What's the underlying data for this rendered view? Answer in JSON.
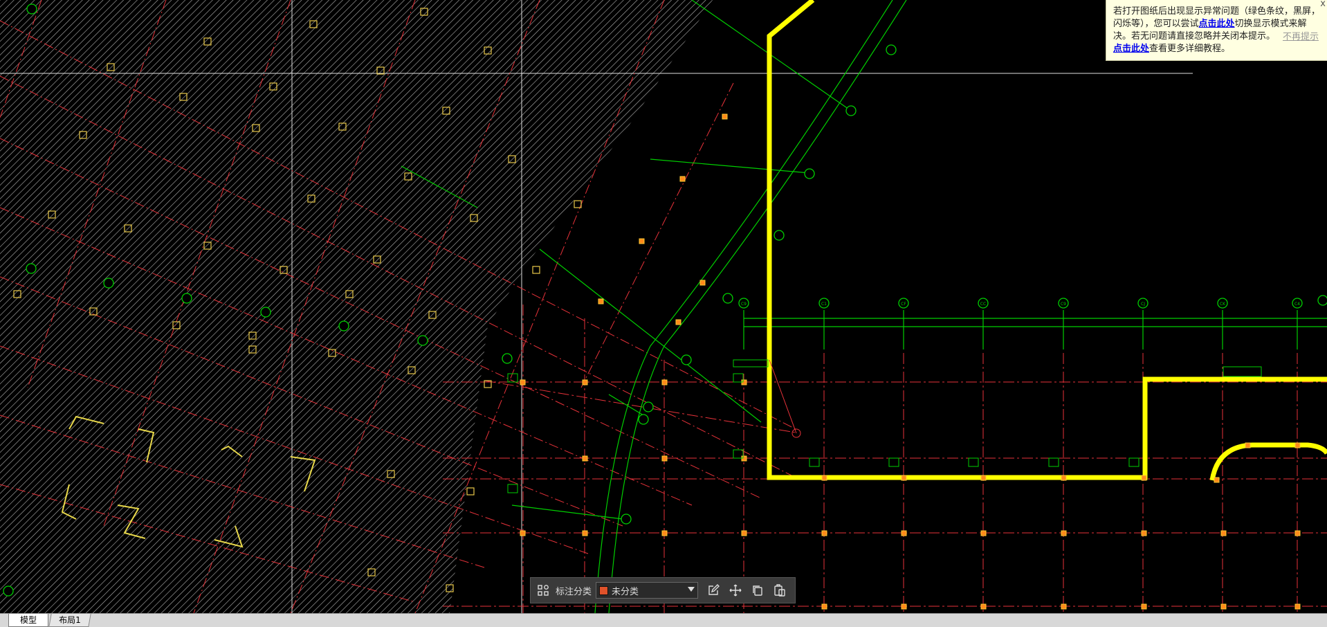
{
  "notice": {
    "line1_a": "若打开图纸后出现显示异常问题（绿色条纹，黑屏，闪烁等），您可以尝试",
    "link1": "点击此处",
    "line1_b": "切换显示模式来解决。若无问题请直接忽略并关闭本提示。",
    "link2": "点击此处",
    "line2_b": "查看更多详细教程。",
    "dismiss": "不再提示",
    "close": "x"
  },
  "toolbar": {
    "label": "标注分类",
    "selected": "未分类",
    "swatch_color": "#e0522a"
  },
  "tabs": {
    "model": "模型",
    "layout1": "布局1"
  },
  "axes": {
    "top_labels": [
      "C9",
      "C1",
      "CF",
      "CC",
      "C9",
      "CJ",
      "CK",
      "C4"
    ],
    "colors": {
      "background": "#000000",
      "axis_line": "#e8323a",
      "dimension": "#00d000",
      "wall": "#ffff00",
      "column": "#ff8a1a",
      "hatch": "#bfbfbf"
    }
  }
}
